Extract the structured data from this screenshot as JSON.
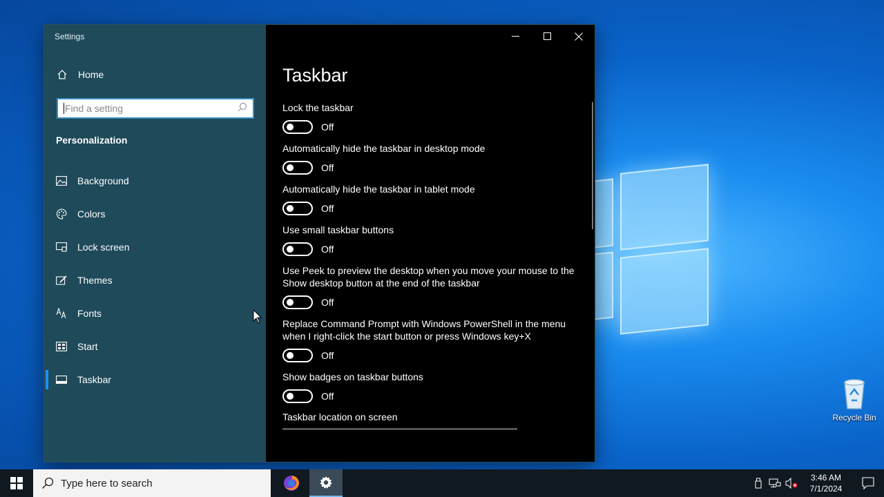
{
  "window": {
    "app_title": "Settings"
  },
  "sidebar": {
    "home_label": "Home",
    "search_placeholder": "Find a setting",
    "section_title": "Personalization",
    "items": [
      {
        "label": "Background",
        "icon": "picture-icon"
      },
      {
        "label": "Colors",
        "icon": "palette-icon"
      },
      {
        "label": "Lock screen",
        "icon": "lock-screen-icon"
      },
      {
        "label": "Themes",
        "icon": "themes-icon"
      },
      {
        "label": "Fonts",
        "icon": "fonts-icon"
      },
      {
        "label": "Start",
        "icon": "start-icon"
      },
      {
        "label": "Taskbar",
        "icon": "taskbar-icon",
        "active": true
      }
    ]
  },
  "content": {
    "page_title": "Taskbar",
    "settings": [
      {
        "label": "Lock the taskbar",
        "state": "Off"
      },
      {
        "label": "Automatically hide the taskbar in desktop mode",
        "state": "Off"
      },
      {
        "label": "Automatically hide the taskbar in tablet mode",
        "state": "Off"
      },
      {
        "label": "Use small taskbar buttons",
        "state": "Off"
      },
      {
        "label": "Use Peek to preview the desktop when you move your mouse to the Show desktop button at the end of the taskbar",
        "state": "Off"
      },
      {
        "label": "Replace Command Prompt with Windows PowerShell in the menu when I right-click the start button or press Windows key+X",
        "state": "Off"
      },
      {
        "label": "Show badges on taskbar buttons",
        "state": "Off"
      }
    ],
    "location_label": "Taskbar location on screen"
  },
  "desktop": {
    "recycle_bin_label": "Recycle Bin"
  },
  "taskbar": {
    "search_placeholder": "Type here to search",
    "clock_time": "3:46 AM",
    "clock_date": "7/1/2024"
  },
  "colors": {
    "sidebar_bg": "#1e4a5a",
    "content_bg": "#000000",
    "accent": "#1e90ff",
    "taskbar_bg": "#101820"
  }
}
